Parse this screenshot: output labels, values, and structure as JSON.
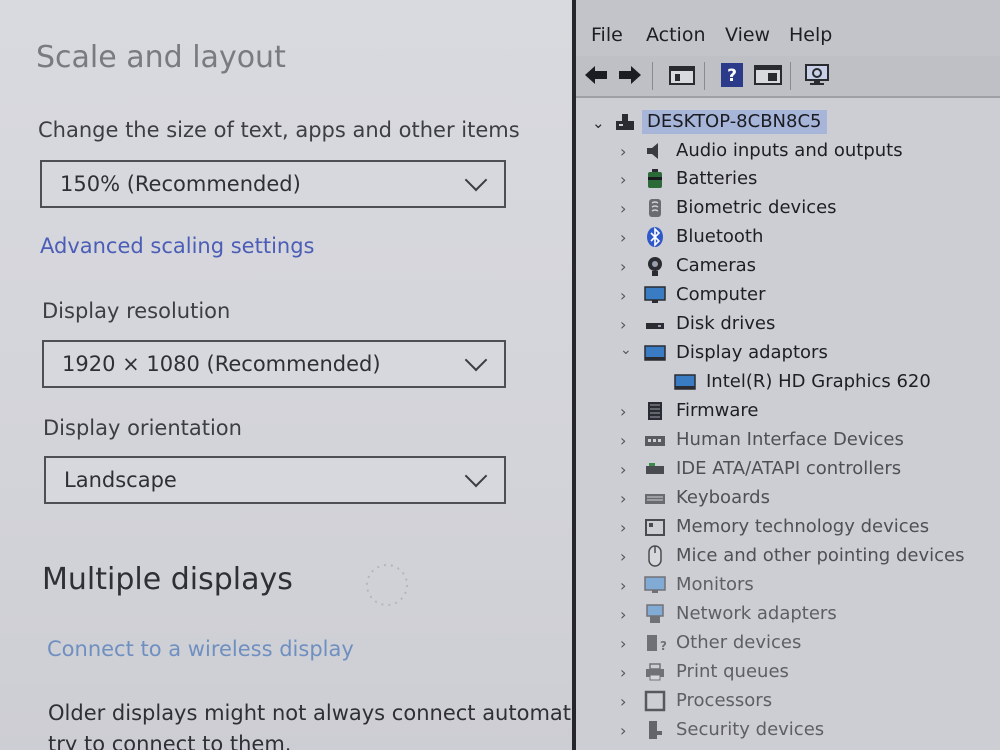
{
  "settings": {
    "title": "Scale and layout",
    "scale_label": "Change the size of text, apps and other items",
    "scale_value": "150% (Recommended)",
    "advanced_link": "Advanced scaling settings",
    "resolution_label": "Display resolution",
    "resolution_value": "1920 × 1080 (Recommended)",
    "orientation_label": "Display orientation",
    "orientation_value": "Landscape",
    "multiple_title": "Multiple displays",
    "wireless_link": "Connect to a wireless display",
    "older_text_1": "Older displays might not always connect automatica",
    "older_text_2": "try to connect to them."
  },
  "device_manager": {
    "menu": [
      "File",
      "Action",
      "View",
      "Help"
    ],
    "toolbar_icons": [
      "back-arrow-icon",
      "forward-arrow-icon",
      "properties-icon",
      "help-icon",
      "update-driver-icon",
      "scan-hardware-icon"
    ],
    "root": "DESKTOP-8CBN8C5",
    "devices": [
      {
        "label": "Audio inputs and outputs",
        "icon": "speaker-icon"
      },
      {
        "label": "Batteries",
        "icon": "battery-icon"
      },
      {
        "label": "Biometric devices",
        "icon": "fingerprint-icon"
      },
      {
        "label": "Bluetooth",
        "icon": "bluetooth-icon"
      },
      {
        "label": "Cameras",
        "icon": "camera-icon"
      },
      {
        "label": "Computer",
        "icon": "monitor-icon"
      },
      {
        "label": "Disk drives",
        "icon": "disk-drive-icon"
      },
      {
        "label": "Display adaptors",
        "icon": "display-adapter-icon"
      },
      {
        "label": "Intel(R) HD Graphics 620",
        "icon": "display-adapter-icon"
      },
      {
        "label": "Firmware",
        "icon": "chip-icon"
      },
      {
        "label": "Human Interface Devices",
        "icon": "hid-icon"
      },
      {
        "label": "IDE ATA/ATAPI controllers",
        "icon": "ide-controller-icon"
      },
      {
        "label": "Keyboards",
        "icon": "keyboard-icon"
      },
      {
        "label": "Memory technology devices",
        "icon": "memory-card-icon"
      },
      {
        "label": "Mice and other pointing devices",
        "icon": "mouse-icon"
      },
      {
        "label": "Monitors",
        "icon": "monitor-icon"
      },
      {
        "label": "Network adapters",
        "icon": "network-icon"
      },
      {
        "label": "Other devices",
        "icon": "unknown-device-icon"
      },
      {
        "label": "Print queues",
        "icon": "printer-icon"
      },
      {
        "label": "Processors",
        "icon": "processor-icon"
      },
      {
        "label": "Security devices",
        "icon": "security-icon"
      }
    ]
  },
  "colors": {
    "accent_link": "#4b5db6",
    "selected_root": "#a7b5d8"
  }
}
